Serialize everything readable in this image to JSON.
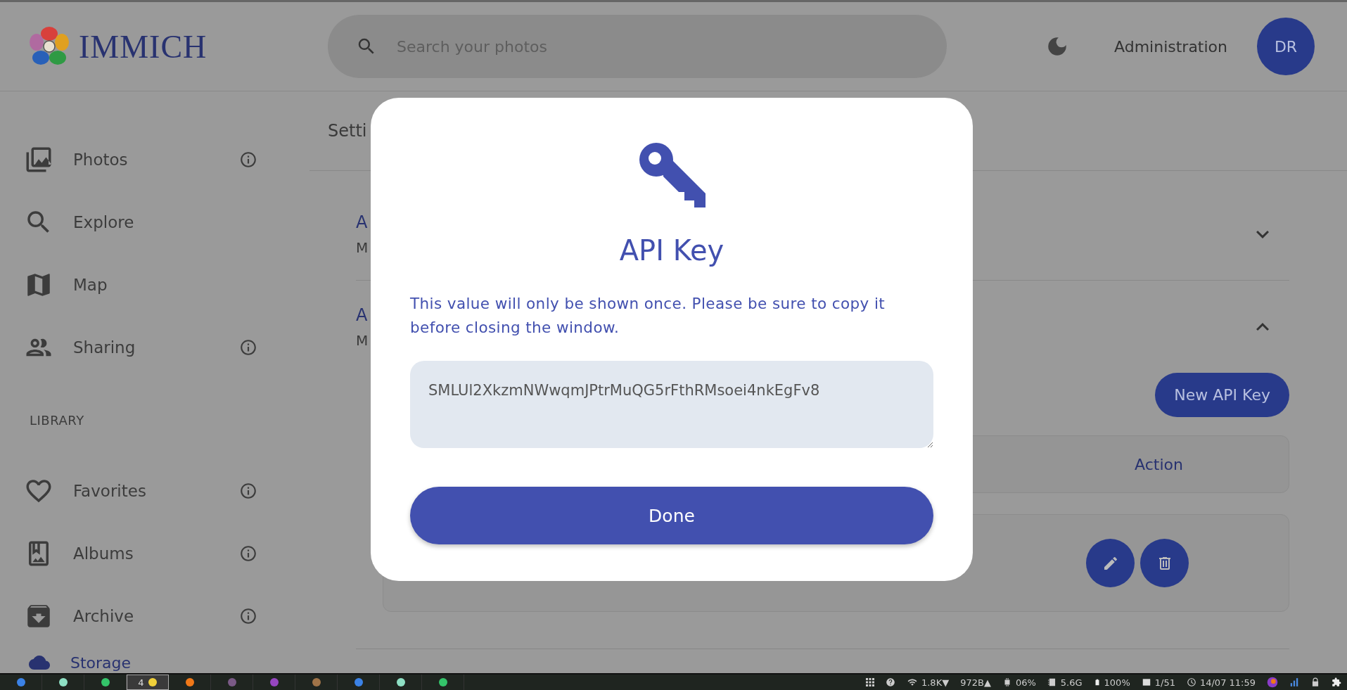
{
  "header": {
    "logo_text": "IMMICH",
    "search": {
      "placeholder": "Search your photos"
    },
    "admin_link": "Administration",
    "avatar": "DR"
  },
  "sidebar": {
    "items": [
      {
        "label": "Photos",
        "kind": "photos",
        "info": true
      },
      {
        "label": "Explore",
        "kind": "explore",
        "info": false
      },
      {
        "label": "Map",
        "kind": "map",
        "info": false
      },
      {
        "label": "Sharing",
        "kind": "sharing",
        "info": true
      }
    ],
    "section": "LIBRARY",
    "library_items": [
      {
        "label": "Favorites",
        "kind": "favorites",
        "info": true
      },
      {
        "label": "Albums",
        "kind": "albums",
        "info": true
      },
      {
        "label": "Archive",
        "kind": "archive",
        "info": true
      }
    ],
    "storage": "Storage"
  },
  "content": {
    "title": "Setti",
    "sections": [
      {
        "title": "A",
        "subtitle": "M",
        "expanded": false
      },
      {
        "title": "A",
        "subtitle": "M",
        "expanded": true
      }
    ],
    "new_key_button": "New API Key",
    "table": {
      "columns": [
        "Action"
      ]
    }
  },
  "dialog": {
    "title": "API Key",
    "message": "This value will only be shown once. Please be sure to copy it before closing the window.",
    "key": "SMLUl2XkzmNWwqmJPtrMuQG5rFthRMsoei4nkEgFv8",
    "button": "Done"
  },
  "taskbar": {
    "workspaces": [
      {
        "color": "#3b82e6",
        "selected": false
      },
      {
        "color": "#8ee0c4",
        "selected": false
      },
      {
        "color": "#34c46a",
        "selected": false
      },
      {
        "label": "4",
        "color": "#f0d03a",
        "selected": true
      },
      {
        "color": "#f07818",
        "selected": false
      },
      {
        "color": "#7a5a86",
        "selected": false
      },
      {
        "color": "#9646c0",
        "selected": false
      },
      {
        "color": "#a07448",
        "selected": false
      },
      {
        "color": "#3b82e6",
        "selected": false
      },
      {
        "color": "#8ee0c4",
        "selected": false
      },
      {
        "color": "#34c46a",
        "selected": false
      }
    ],
    "status": [
      {
        "kind": "grid"
      },
      {
        "kind": "help"
      },
      {
        "kind": "wifi",
        "text": "1.8K▼"
      },
      {
        "kind": "plain",
        "text": "972B▲"
      },
      {
        "kind": "cpu",
        "text": "06%"
      },
      {
        "kind": "memory",
        "text": "5.6G"
      },
      {
        "kind": "battery",
        "text": "100%"
      },
      {
        "kind": "window",
        "text": "1/51"
      },
      {
        "kind": "clock",
        "text": "14/07 11:59"
      },
      {
        "kind": "app"
      },
      {
        "kind": "bars"
      },
      {
        "kind": "lock"
      },
      {
        "kind": "puzzle"
      }
    ]
  }
}
